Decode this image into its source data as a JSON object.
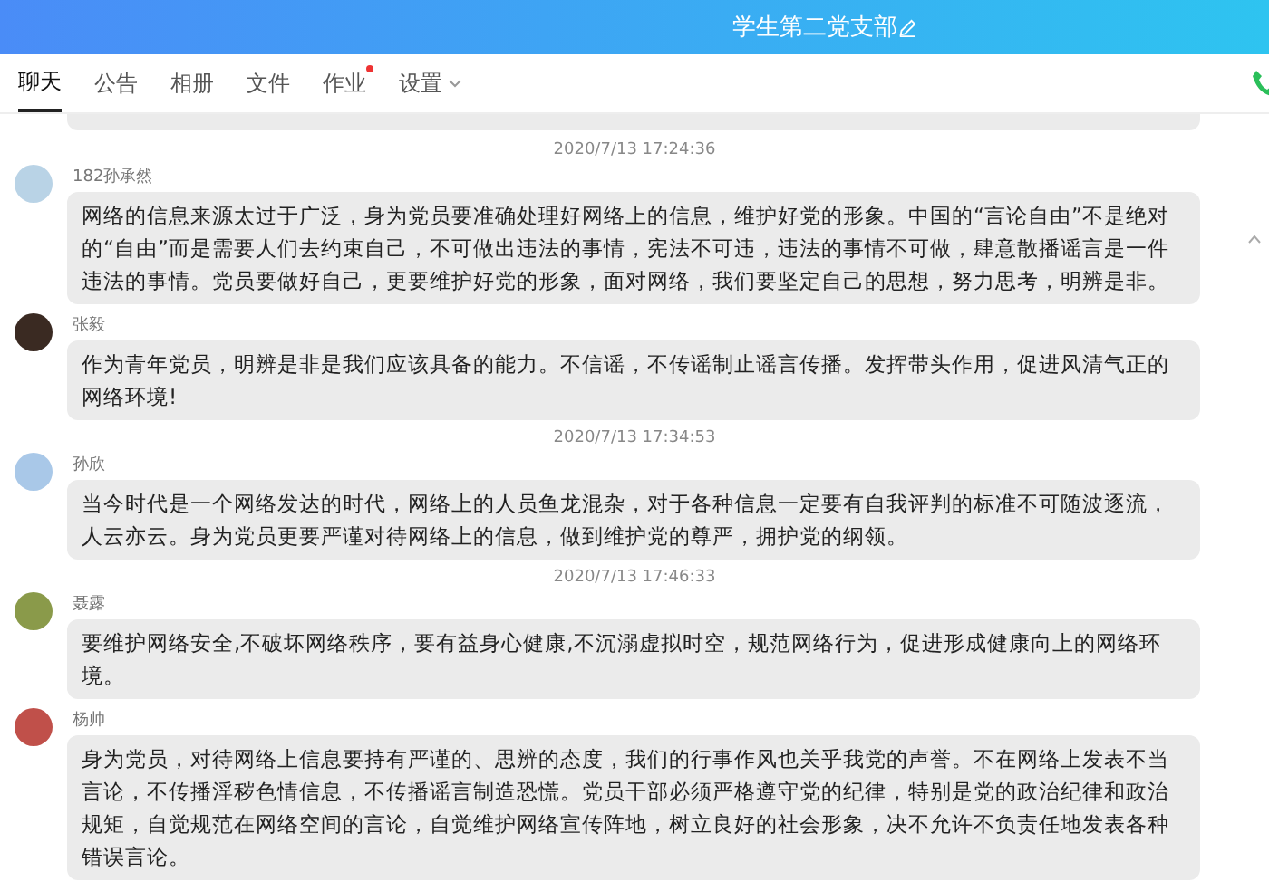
{
  "header": {
    "title": "学生第二党支部"
  },
  "tabs": [
    {
      "label": "聊天",
      "selected": true,
      "dot": false,
      "kind": "plain"
    },
    {
      "label": "公告",
      "selected": false,
      "dot": false,
      "kind": "plain"
    },
    {
      "label": "相册",
      "selected": false,
      "dot": false,
      "kind": "plain"
    },
    {
      "label": "文件",
      "selected": false,
      "dot": false,
      "kind": "plain"
    },
    {
      "label": "作业",
      "selected": false,
      "dot": true,
      "kind": "plain"
    },
    {
      "label": "设置",
      "selected": false,
      "dot": false,
      "kind": "dropdown"
    }
  ],
  "feed": [
    {
      "kind": "timestamp",
      "text": "2020/7/13 17:24:36"
    },
    {
      "kind": "message",
      "sender": "182孙承然",
      "color": "#b9d3e6",
      "text": "网络的信息来源太过于广泛，身为党员要准确处理好网络上的信息，维护好党的形象。中国的“言论自由”不是绝对的“自由”而是需要人们去约束自己，不可做出违法的事情，宪法不可违，违法的事情不可做，肆意散播谣言是一件违法的事情。党员要做好自己，更要维护好党的形象，面对网络，我们要坚定自己的思想，努力思考，明辨是非。"
    },
    {
      "kind": "message",
      "sender": "张毅",
      "color": "#3a2a22",
      "text": "作为青年党员，明辨是非是我们应该具备的能力。不信谣，不传谣制止谣言传播。发挥带头作用，促进风清气正的网络环境!"
    },
    {
      "kind": "timestamp",
      "text": "2020/7/13 17:34:53"
    },
    {
      "kind": "message",
      "sender": "孙欣",
      "color": "#a9c8e8",
      "text": "当今时代是一个网络发达的时代，网络上的人员鱼龙混杂，对于各种信息一定要有自我评判的标准不可随波逐流，人云亦云。身为党员更要严谨对待网络上的信息，做到维护党的尊严，拥护党的纲领。"
    },
    {
      "kind": "timestamp",
      "text": "2020/7/13 17:46:33"
    },
    {
      "kind": "message",
      "sender": "聂露",
      "color": "#8a9a4a",
      "text": "要维护网络安全,不破坏网络秩序，要有益身心健康,不沉溺虚拟时空，规范网络行为，促进形成健康向上的网络环境。"
    },
    {
      "kind": "message",
      "sender": "杨帅",
      "color": "#c0504a",
      "text": "身为党员，对待网络上信息要持有严谨的、思辨的态度，我们的行事作风也关乎我党的声誉。不在网络上发表不当言论，不传播淫秽色情信息，不传播谣言制造恐慌。党员干部必须严格遵守党的纪律，特别是党的政治纪律和政治规矩，自觉规范在网络空间的言论，自觉维护网络宣传阵地，树立良好的社会形象，决不允许不负责任地发表各种错误言论。"
    }
  ]
}
